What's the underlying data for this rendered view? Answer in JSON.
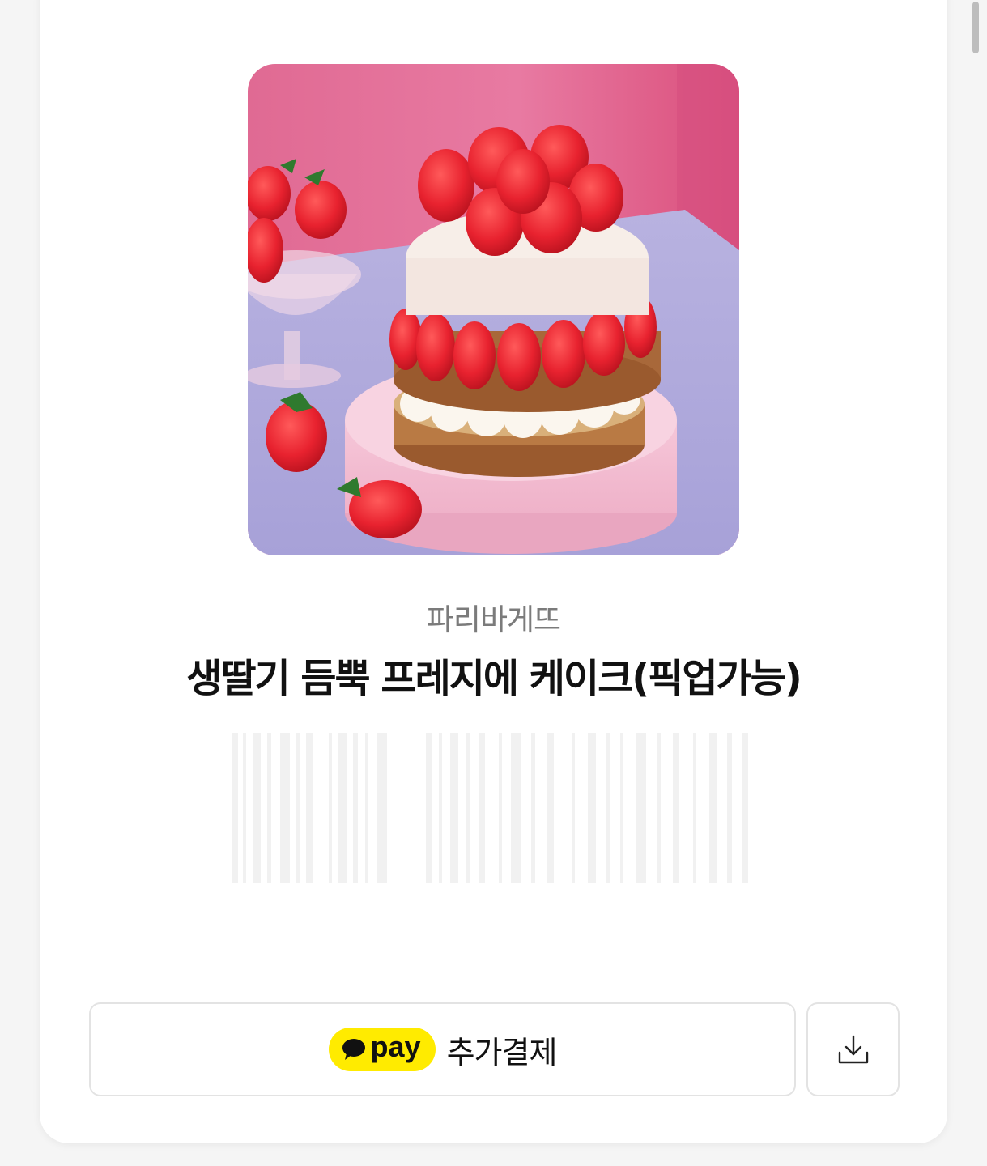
{
  "product": {
    "brand": "파리바게뜨",
    "title": "생딸기 듬뿍 프레지에 케이크(픽업가능)",
    "image_icon": "strawberry-cake-photo"
  },
  "actions": {
    "pay_badge": "pay",
    "pay_label": "추가결제",
    "download_icon": "download-icon"
  },
  "colors": {
    "kakao_yellow": "#ffeb00",
    "card_background": "#ffffff",
    "page_background": "#f5f5f5"
  }
}
